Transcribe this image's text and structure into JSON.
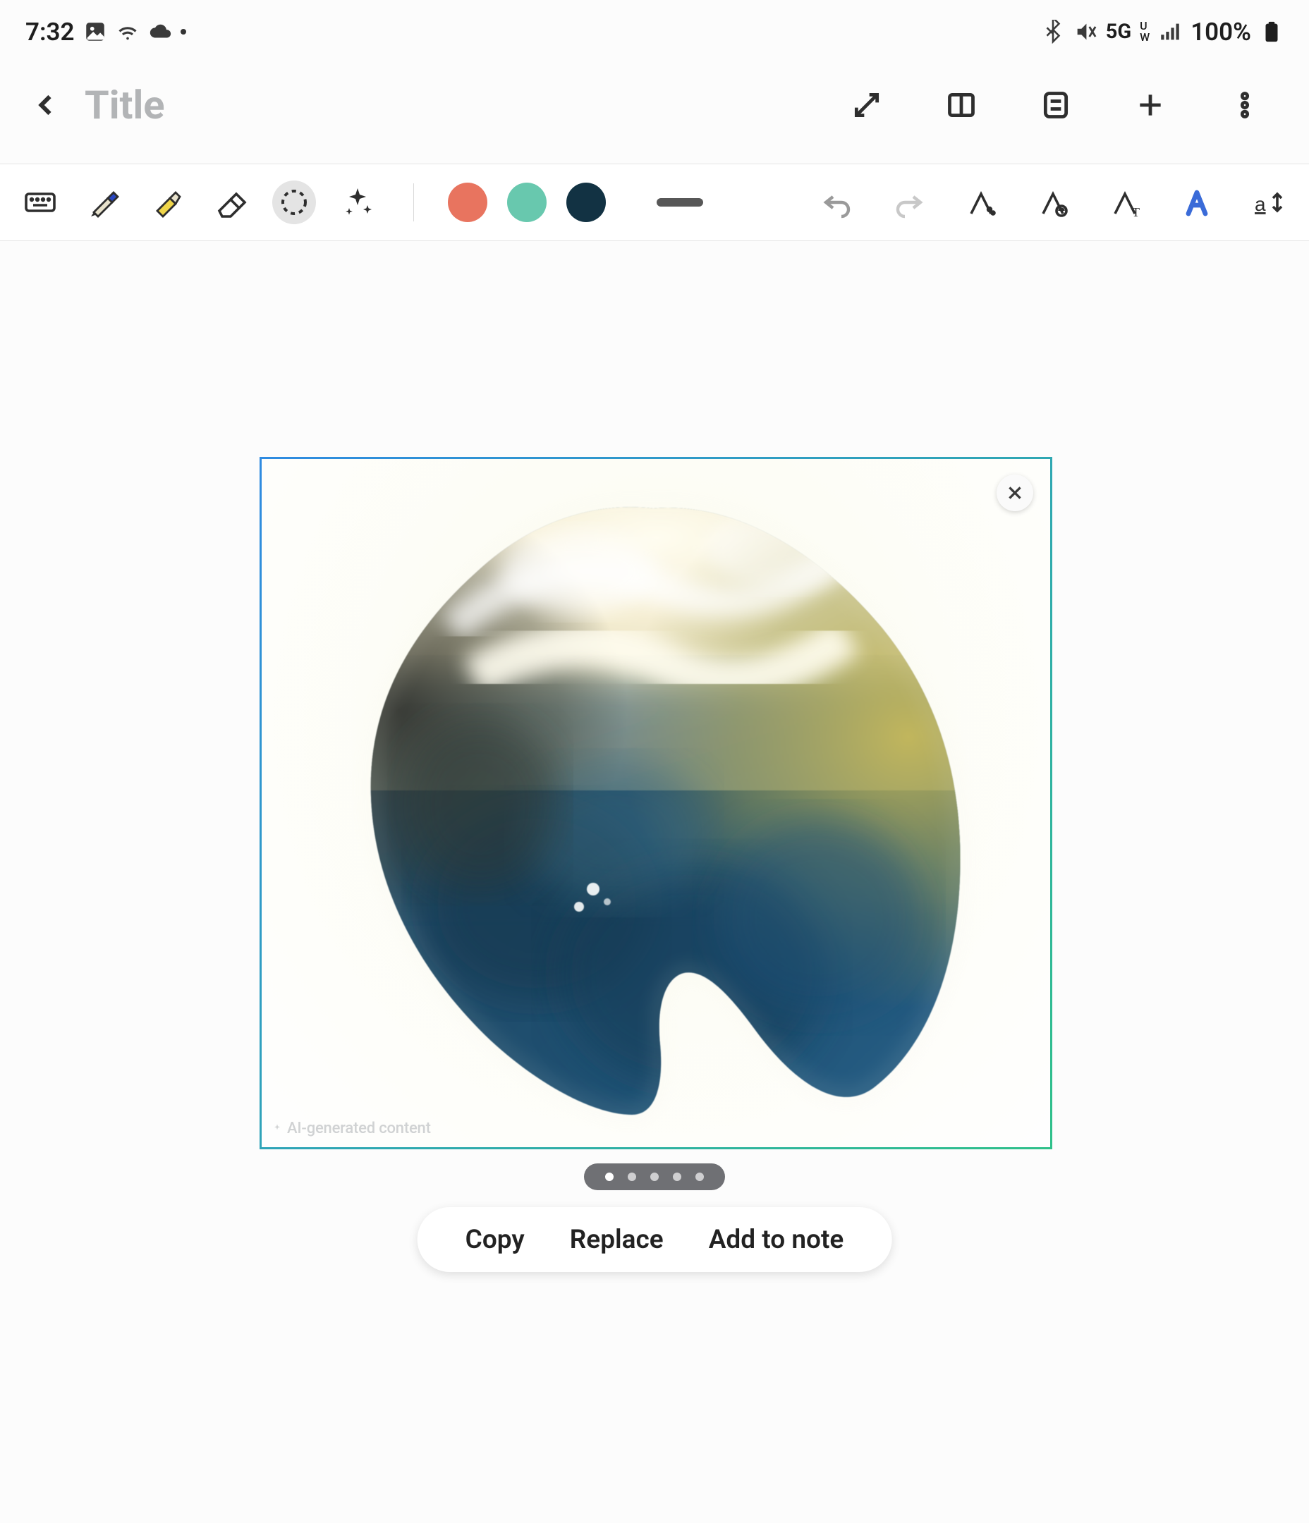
{
  "status": {
    "time": "7:32",
    "battery": "100%",
    "network": "5G"
  },
  "header": {
    "title": "Title"
  },
  "selection": {
    "ai_label": "AI-generated content",
    "pager_count": 5,
    "pager_active": 0
  },
  "actions": {
    "copy": "Copy",
    "replace": "Replace",
    "add": "Add to note"
  }
}
